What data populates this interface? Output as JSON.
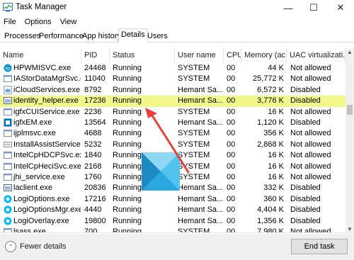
{
  "window": {
    "title": "Task Manager",
    "controls": {
      "minimize": "—",
      "maximize": "☐",
      "close": "✕"
    }
  },
  "menu": [
    "File",
    "Options",
    "View"
  ],
  "tabs": [
    {
      "label": "Processes"
    },
    {
      "label": "Performance"
    },
    {
      "label": "App history"
    },
    {
      "label": "Details",
      "active": true
    },
    {
      "label": "Users"
    }
  ],
  "columns": [
    {
      "label": "Name"
    },
    {
      "label": "PID"
    },
    {
      "label": "Status"
    },
    {
      "label": "User name"
    },
    {
      "label": "CPU"
    },
    {
      "label": "Memory (ac..."
    },
    {
      "label": "UAC virtualizati..."
    }
  ],
  "sort_indicator": "^",
  "rows": [
    {
      "icon": "hp-icon",
      "name": "HPWMISVC.exe",
      "pid": "24468",
      "status": "Running",
      "user": "SYSTEM",
      "cpu": "00",
      "memory": "44 K",
      "uac": "Not allowed"
    },
    {
      "icon": "service-icon",
      "name": "IAStorDataMgrSvc.exe",
      "pid": "11040",
      "status": "Running",
      "user": "SYSTEM",
      "cpu": "00",
      "memory": "25,772 K",
      "uac": "Not allowed"
    },
    {
      "icon": "cloud-icon",
      "name": "iCloudServices.exe",
      "pid": "8792",
      "status": "Running",
      "user": "Hemant Sa...",
      "cpu": "00",
      "memory": "6,572 K",
      "uac": "Disabled"
    },
    {
      "icon": "app-icon",
      "name": "identity_helper.exe",
      "pid": "17236",
      "status": "Running",
      "user": "Hemant Sa...",
      "cpu": "00",
      "memory": "3,776 K",
      "uac": "Disabled",
      "highlight": true
    },
    {
      "icon": "service-icon",
      "name": "igfxCUIService.exe",
      "pid": "2236",
      "status": "Running",
      "user": "SYSTEM",
      "cpu": "00",
      "memory": "16 K",
      "uac": "Not allowed"
    },
    {
      "icon": "intel-icon",
      "name": "igfxEM.exe",
      "pid": "13564",
      "status": "Running",
      "user": "Hemant Sa...",
      "cpu": "00",
      "memory": "1,120 K",
      "uac": "Disabled"
    },
    {
      "icon": "service-icon",
      "name": "ijplmsvc.exe",
      "pid": "4688",
      "status": "Running",
      "user": "SYSTEM",
      "cpu": "00",
      "memory": "356 K",
      "uac": "Not allowed"
    },
    {
      "icon": "install-icon",
      "name": "InstallAssistService.exe",
      "pid": "5232",
      "status": "Running",
      "user": "SYSTEM",
      "cpu": "00",
      "memory": "2,868 K",
      "uac": "Not allowed"
    },
    {
      "icon": "service-icon",
      "name": "IntelCpHDCPSvc.exe",
      "pid": "1840",
      "status": "Running",
      "user": "SYSTEM",
      "cpu": "00",
      "memory": "16 K",
      "uac": "Not allowed"
    },
    {
      "icon": "service-icon",
      "name": "IntelCpHeciSvc.exe",
      "pid": "2168",
      "status": "Running",
      "user": "SYSTEM",
      "cpu": "00",
      "memory": "16 K",
      "uac": "Not allowed"
    },
    {
      "icon": "service-icon",
      "name": "jhi_service.exe",
      "pid": "1760",
      "status": "Running",
      "user": "SYSTEM",
      "cpu": "00",
      "memory": "16 K",
      "uac": "Not allowed"
    },
    {
      "icon": "app-icon",
      "name": "laclient.exe",
      "pid": "20836",
      "status": "Running",
      "user": "Hemant Sa...",
      "cpu": "00",
      "memory": "332 K",
      "uac": "Disabled"
    },
    {
      "icon": "logi-icon",
      "name": "LogiOptions.exe",
      "pid": "17216",
      "status": "Running",
      "user": "Hemant Sa...",
      "cpu": "00",
      "memory": "360 K",
      "uac": "Disabled"
    },
    {
      "icon": "logi-icon",
      "name": "LogiOptionsMgr.exe",
      "pid": "4440",
      "status": "Running",
      "user": "Hemant Sa...",
      "cpu": "00",
      "memory": "4,404 K",
      "uac": "Disabled"
    },
    {
      "icon": "logi-icon",
      "name": "LogiOverlay.exe",
      "pid": "19800",
      "status": "Running",
      "user": "Hemant Sa...",
      "cpu": "00",
      "memory": "1,356 K",
      "uac": "Disabled"
    },
    {
      "icon": "service-icon",
      "name": "lsass.exe",
      "pid": "700",
      "status": "Running",
      "user": "SYSTEM",
      "cpu": "00",
      "memory": "7,980 K",
      "uac": "Not allowed"
    }
  ],
  "footer": {
    "fewer_details": "Fewer details",
    "end_task": "End task"
  },
  "annotation": {
    "arrow_color": "#e8403a"
  },
  "colors": {
    "highlight": "#f2f78a",
    "logo_blue": "#29a9e0"
  }
}
